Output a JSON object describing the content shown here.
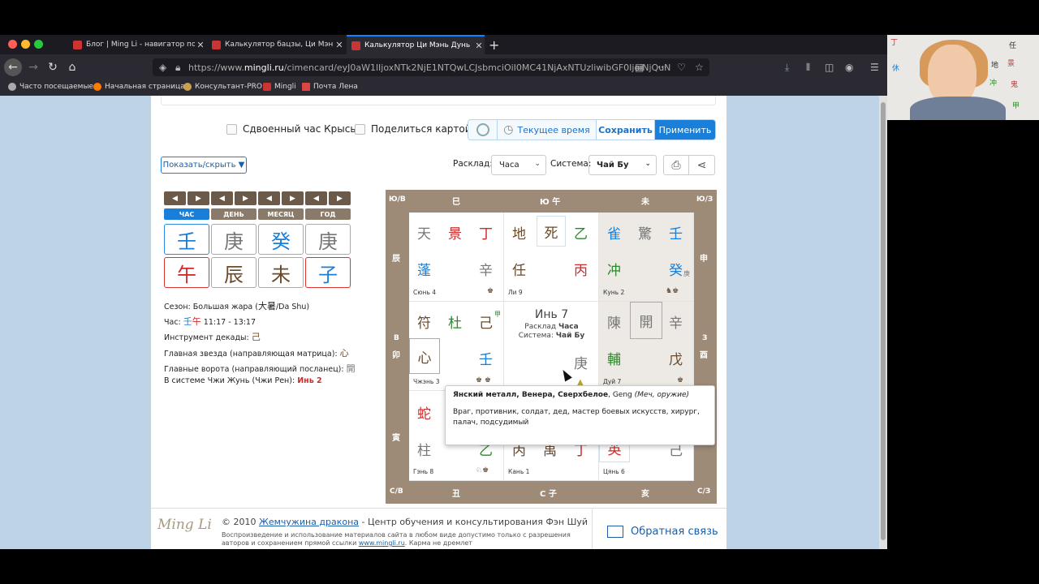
{
  "browser": {
    "tabs": [
      {
        "title": "Блог | Ming Li - навигатор по "
      },
      {
        "title": "Калькулятор бацзы, Ци Мэнь "
      },
      {
        "title": "Калькулятор Ци Мэнь Дунь Ц"
      }
    ],
    "new_tab": "+",
    "url_prefix": "https://www.",
    "url_host": "mingli.ru",
    "url_rest": "/cimencard/eyJ0aW1lIjoxNTk2NjE1NTQwLCJsbmciOiI0MC41NjAxNTUzliwibGF0IjoiNjQuN",
    "bookmarks": [
      "Часто посещаемые",
      "Начальная страница",
      "Консультант-PRO",
      "Mingli",
      "Почта Лена"
    ]
  },
  "video": {
    "chars": [
      "丁",
      "休",
      "地",
      "景",
      "冲",
      "任",
      "鬼",
      "甲"
    ]
  },
  "options": {
    "double_rat_hour": "Сдвоенный час Крысы",
    "share_chart": "Поделиться картой"
  },
  "toolbar": {
    "current_time": "Текущее время",
    "save": "Сохранить",
    "apply": "Применить"
  },
  "controls": {
    "show_hide": "Показать/скрыть ▼",
    "layout_label": "Расклад:",
    "layout_value": "Часа",
    "system_label": "Система:",
    "system_value": "Чай Бу"
  },
  "pillars": {
    "arrow_left": "◀",
    "arrow_right": "▶",
    "labels": [
      "ЧАС",
      "ДЕНЬ",
      "МЕСЯЦ",
      "ГОД"
    ],
    "stems": [
      "壬",
      "庚",
      "癸",
      "庚"
    ],
    "branches": [
      "午",
      "辰",
      "未",
      "子"
    ],
    "stem_colors": [
      "#1a7fd8",
      "#777777",
      "#1a7fd8",
      "#777777"
    ],
    "branch_colors": [
      "#d12a2a",
      "#6b4a2a",
      "#6b4a2a",
      "#1a7fd8"
    ]
  },
  "info": {
    "season_prefix": "Сезон: Большая жара (",
    "season_hz": "大暑",
    "season_suffix": "/Da Shu)",
    "hour_label": "Час: ",
    "hour_stem": "壬",
    "hour_branch": "午",
    "hour_time": " 11:17 - 13:17",
    "decade_label": "Инструмент декады: ",
    "decade_hz": "己",
    "star_label": "Главная звезда (направляющая матрица): ",
    "star_hz": "心",
    "gate_label": "Главные ворота (направляющий посланец): ",
    "gate_hz": "開",
    "zhi_label": "В системе Чжи Жунь (Чжи Рен): ",
    "zhi_value": "Инь 2"
  },
  "chart": {
    "directions": {
      "nw_top": "Ю/В",
      "top_l": "巳",
      "top_c": "Ю 午",
      "top_r": "未",
      "ne_top": "Ю/З",
      "left_1": "辰",
      "left_2a": "В",
      "left_2b": "卯",
      "left_3": "寅",
      "right_1": "申",
      "right_2a": "З",
      "right_2b": "酉",
      "right_3": "戌",
      "sw_bot": "С/В",
      "bot_l": "丑",
      "bot_c": "С 子",
      "bot_r": "亥",
      "se_bot": "С/З"
    },
    "palaces": [
      {
        "name": "Сюнь 4",
        "chars": [
          "天",
          "景",
          "丁",
          "蓬",
          "辛"
        ],
        "icon": "♚"
      },
      {
        "name": "Ли 9",
        "chars": [
          "地",
          "死",
          "乙",
          "任",
          "丙"
        ],
        "icon": ""
      },
      {
        "name": "Кунь 2",
        "chars": [
          "雀",
          "驚",
          "壬",
          "冲",
          "癸"
        ],
        "sub": "庚",
        "icon": "♞♚"
      },
      {
        "name": "Чжэнь 3",
        "chars": [
          "符",
          "杜",
          "己",
          "心",
          "壬"
        ],
        "sub": "甲",
        "icon": "♚ ♚"
      },
      {
        "name": "Дуй 7",
        "chars": [
          "陳",
          "開",
          "辛",
          "輔",
          "戊"
        ],
        "icon": "♚"
      },
      {
        "name": "Гэнь 8",
        "chars": [
          "蛇",
          "柱",
          "乙"
        ],
        "icon": "♘♚"
      },
      {
        "name": "Кань 1",
        "chars": [
          "丙",
          "禹",
          "丁"
        ],
        "icon": ""
      },
      {
        "name": "Цянь 6",
        "chars": [
          "英",
          "己"
        ],
        "icon": ""
      }
    ],
    "center": {
      "title": "Инь 7",
      "layout_prefix": "Расклад ",
      "layout_value": "Часа",
      "system_prefix": "Система: ",
      "system_value": "Чай Бу",
      "stem": "庚"
    },
    "colors": {
      "red": "#d12a2a",
      "green": "#2a8a2a",
      "blue": "#1a7fd8",
      "brown": "#6b4a2a",
      "gray": "#777777",
      "frame": "#9d8b78"
    }
  },
  "tooltip": {
    "title_bold": "Янский металл, Венера, Сверхбелое",
    "title_normal": ", Geng ",
    "title_italic": "(Меч, оружие)",
    "body": "Враг, противник, солдат, дед, мастер боевых искусств, хирург, палач, подсудимый"
  },
  "footer": {
    "logo": "Ming Li",
    "copyright_prefix": "© 2010 ",
    "copyright_link": "Жемчужина дракона",
    "copyright_suffix": " - Центр обучения и консультирования Фэн Шуй",
    "notice": "Воспроизведение и использование материалов сайта в любом виде допустимо только с разрешения авторов и сохранением прямой ссылки ",
    "notice_link": "www.mingli.ru",
    "notice_suffix": ". Карма не дремлет",
    "feedback": "Обратная связь"
  }
}
